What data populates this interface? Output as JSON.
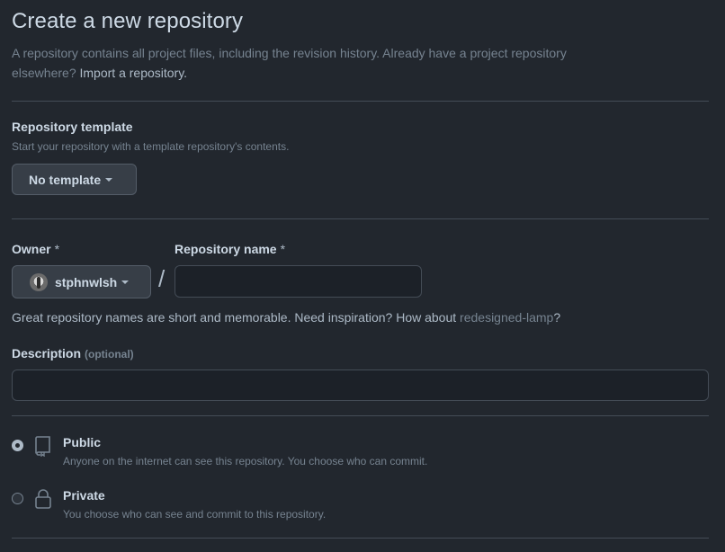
{
  "header": {
    "title": "Create a new repository",
    "subtitle_line1": "A repository contains all project files, including the revision history. Already have a project repository",
    "subtitle_line2_prefix": "elsewhere?",
    "import_link": "Import a repository."
  },
  "template": {
    "label": "Repository template",
    "hint": "Start your repository with a template repository's contents.",
    "button_label": "No template"
  },
  "owner": {
    "label": "Owner",
    "required_mark": "*",
    "selected": "stphnwlsh"
  },
  "separator": "/",
  "repo_name": {
    "label": "Repository name",
    "required_mark": "*",
    "value": "",
    "placeholder": ""
  },
  "name_hint": {
    "text": "Great repository names are short and memorable. Need inspiration? How about",
    "suggestion": "redesigned-lamp",
    "suffix": "?"
  },
  "description": {
    "label": "Description",
    "optional": "(optional)",
    "value": "",
    "placeholder": ""
  },
  "visibility": {
    "selected": "public",
    "options": [
      {
        "id": "public",
        "title": "Public",
        "desc": "Anyone on the internet can see this repository. You choose who can commit.",
        "icon": "repo-icon"
      },
      {
        "id": "private",
        "title": "Private",
        "desc": "You choose who can see and commit to this repository.",
        "icon": "lock-icon"
      }
    ]
  },
  "colors": {
    "background": "#22272e",
    "text_primary": "#cdd9e5",
    "text_muted": "#768390",
    "border": "#444c56"
  }
}
